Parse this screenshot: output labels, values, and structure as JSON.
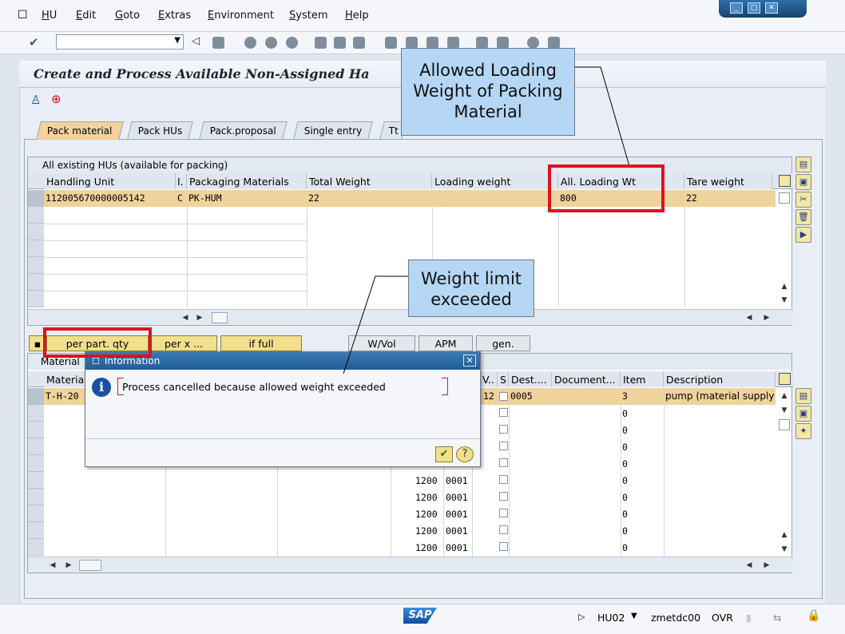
{
  "menu": [
    "HU",
    "Edit",
    "Goto",
    "Extras",
    "Environment",
    "System",
    "Help"
  ],
  "window_controls": [
    "minimize-icon",
    "maximize-icon",
    "close-icon"
  ],
  "command_field": {
    "value": ""
  },
  "page_title": "Create and Process Available Non-Assigned Ha",
  "tabs": [
    "Pack material",
    "Pack HUs",
    "Pack.proposal",
    "Single entry",
    "Tt"
  ],
  "hu_grid": {
    "title": "All existing HUs (available for packing)",
    "headers": [
      "Handling Unit",
      "I.",
      "Packaging Materials",
      "Total Weight",
      "Loading weight",
      "All. Loading Wt",
      "Tare weight"
    ],
    "rows": [
      [
        "112005670000005142",
        "C",
        "PK-HUM",
        "22",
        "",
        "800",
        "22"
      ]
    ]
  },
  "action_buttons": [
    "per part. qty",
    "per x ...",
    "if full",
    "W/Vol",
    "APM",
    "gen."
  ],
  "material_grid": {
    "title": "Material",
    "headers": [
      "Material",
      "V..",
      "S",
      "Dest....",
      "Document...",
      "Item",
      "Description"
    ],
    "first_row": {
      "material": "T-H-20",
      "v": "12",
      "dest": "0005",
      "item": "3",
      "description": "pump  (material supply"
    },
    "item_values": [
      "0",
      "0",
      "0",
      "0",
      "0",
      "0",
      "0",
      "0",
      "0"
    ],
    "plant_rows": [
      [
        "1200",
        "0001"
      ],
      [
        "1200",
        "0001"
      ],
      [
        "1200",
        "0001"
      ],
      [
        "1200",
        "0001"
      ],
      [
        "1200",
        "0001"
      ]
    ]
  },
  "popup": {
    "title": "Information",
    "message": "Process cancelled because allowed weight exceeded"
  },
  "callouts": {
    "loading_weight": "Allowed Loading Weight of Packing Material",
    "weight_limit": "Weight limit exceeded"
  },
  "status_bar": {
    "transaction": "HU02",
    "server": "zmetdc00",
    "mode": "OVR"
  },
  "colors": {
    "highlight_row": "#efd39a",
    "callout_bg": "#b5d7f5",
    "annotation_red": "#e0111d",
    "popup_title": "#235d96"
  }
}
